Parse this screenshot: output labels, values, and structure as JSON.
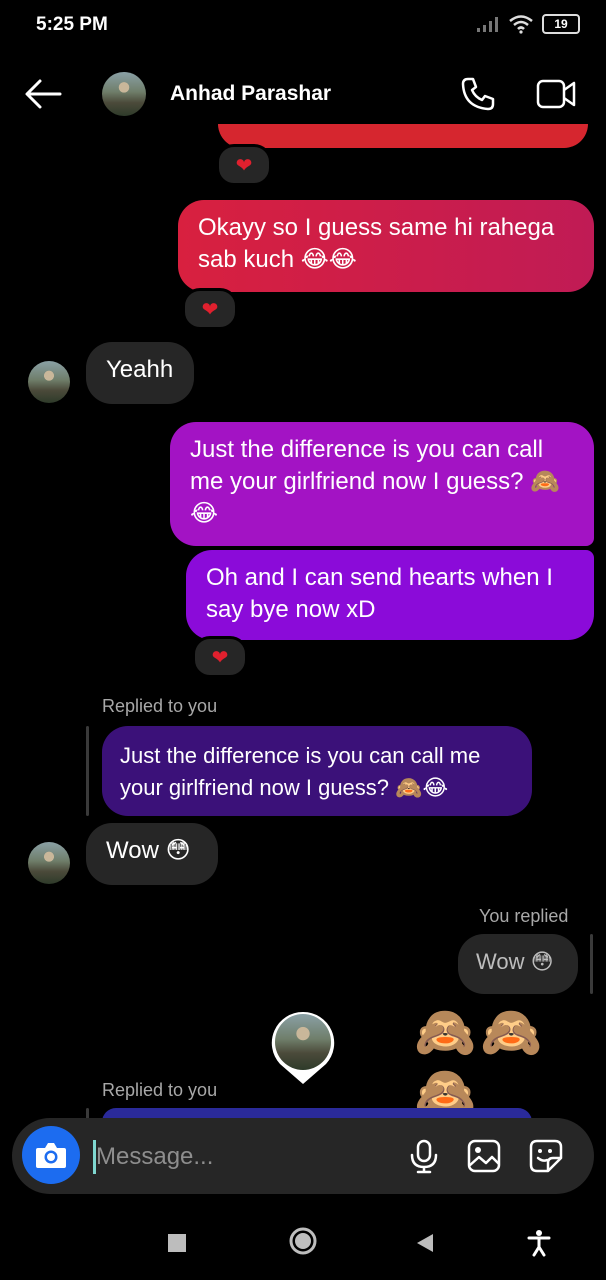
{
  "status_bar": {
    "time": "5:25 PM",
    "battery": "19"
  },
  "header": {
    "contact_name": "Anhad Parashar"
  },
  "messages": {
    "m1": "Okayy so I guess same hi rahega sab kuch 😂😂",
    "m2": "Yeahh",
    "m3": "Just the difference is you can call me your girlfriend now I guess? 🙈😂",
    "m4": "Oh and I can send hearts when I say bye now xD",
    "reply1_label": "Replied to you",
    "reply1_quote": "Just the difference is you can call me your girlfriend now I guess? 🙈😂",
    "m5": "Wow 😳",
    "you_replied_label": "You replied",
    "you_replied_quote": "Wow 😳",
    "m6": "🙈🙈🙈",
    "reply2_label": "Replied to you"
  },
  "reactions": {
    "heart": "❤"
  },
  "composer": {
    "placeholder": "Message..."
  },
  "colors": {
    "outgoing_red": "#d31f44",
    "outgoing_magenta": "#a112c8",
    "outgoing_purple": "#8a0ad8",
    "quoted_indigo": "#3a0f7a",
    "camera_blue": "#1c6cf0"
  },
  "icons": [
    "back-arrow-icon",
    "phone-icon",
    "video-call-icon",
    "camera-icon",
    "microphone-icon",
    "gallery-icon",
    "sticker-icon",
    "square-nav-icon",
    "home-nav-icon",
    "back-nav-icon",
    "accessibility-icon"
  ]
}
